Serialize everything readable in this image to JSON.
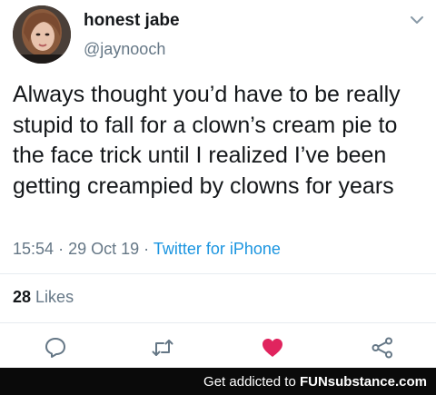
{
  "author": {
    "display_name": "honest jabe",
    "handle": "@jaynooch"
  },
  "tweet": {
    "text": "Always thought you’d have to be really stupid to fall for a clown’s cream pie to the face trick until I realized I’ve been getting creampied by clowns for years",
    "time": "15:54",
    "separator": "·",
    "date": "29 Oct 19",
    "source": "Twitter for iPhone",
    "likes_count": "28",
    "likes_label": "Likes"
  },
  "icons": {
    "menu": "chevron-down-icon",
    "reply": "reply-icon",
    "retweet": "retweet-icon",
    "like": "heart-icon",
    "share": "share-icon"
  },
  "footer": {
    "text": "Get addicted to",
    "brand": "FUNsubstance.com"
  },
  "colors": {
    "text": "#14171a",
    "secondary": "#657786",
    "link": "#1b95e0",
    "like": "#e0245e",
    "footer_bg": "#0a0a0a"
  }
}
